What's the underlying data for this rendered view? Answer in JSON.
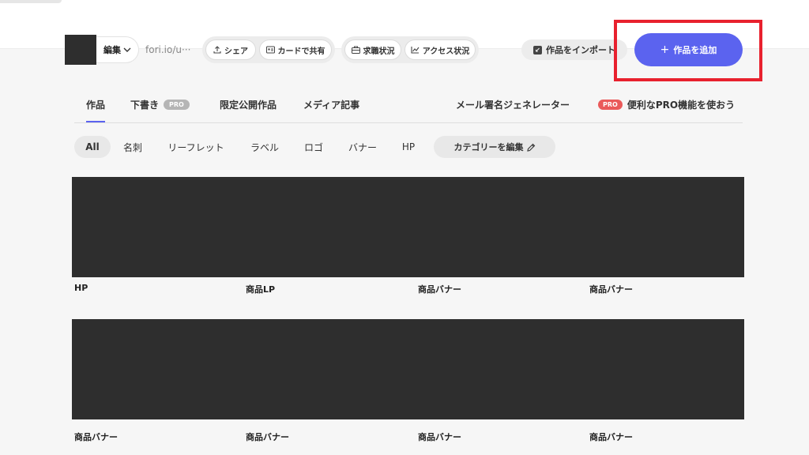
{
  "toolbar": {
    "edit_label": "編集",
    "url_text": "fori.io/u···",
    "share_label": "シェア",
    "card_share_label": "カードで共有",
    "job_status_label": "求職状況",
    "access_status_label": "アクセス状況",
    "import_label": "作品をインポート",
    "add_label": "作品を追加"
  },
  "tabs": [
    {
      "label": "作品",
      "active": true
    },
    {
      "label": "下書き",
      "badge": "PRO"
    },
    {
      "label": "限定公開作品"
    },
    {
      "label": "メディア記事"
    },
    {
      "label": "メール署名ジェネレーター"
    },
    {
      "label": "便利なPRO機能を使おう",
      "badge": "PRO"
    }
  ],
  "categories": [
    {
      "label": "All",
      "active": true
    },
    {
      "label": "名刺"
    },
    {
      "label": "リーフレット"
    },
    {
      "label": "ラベル"
    },
    {
      "label": "ロゴ"
    },
    {
      "label": "バナー"
    },
    {
      "label": "HP"
    }
  ],
  "category_edit_label": "カテゴリーを編集",
  "works": [
    {
      "label": "HP"
    },
    {
      "label": "商品LP"
    },
    {
      "label": "商品バナー"
    },
    {
      "label": "商品バナー"
    },
    {
      "label": "商品バナー"
    },
    {
      "label": "商品バナー"
    },
    {
      "label": "商品バナー"
    },
    {
      "label": "商品バナー"
    }
  ],
  "colors": {
    "accent": "#5b63ef",
    "highlight": "#e8212e",
    "pro_badge": "#ea5a5a"
  },
  "icons": {
    "share": "upload-icon",
    "card": "card-icon",
    "job": "briefcase-icon",
    "access": "chart-icon",
    "import": "import-icon",
    "add": "plus-icon",
    "edit_category": "pencil-icon",
    "edit_menu": "chevron-down-icon"
  }
}
